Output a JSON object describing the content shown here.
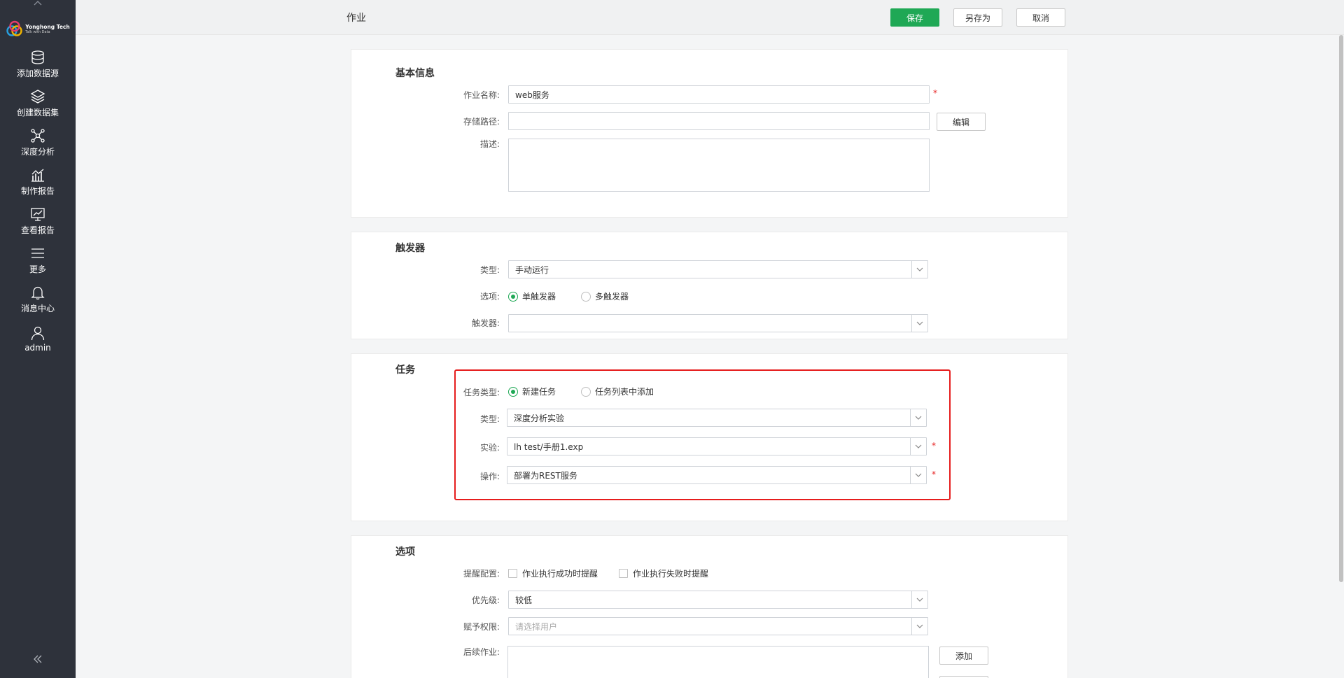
{
  "sidebar": {
    "logo": {
      "line1": "Yonghong Tech",
      "line2": "Talk with Data"
    },
    "items": [
      {
        "label": "添加数据源",
        "icon": "database-icon"
      },
      {
        "label": "创建数据集",
        "icon": "layers-icon"
      },
      {
        "label": "深度分析",
        "icon": "network-icon"
      },
      {
        "label": "制作报告",
        "icon": "bar-chart-icon"
      },
      {
        "label": "查看报告",
        "icon": "monitor-chart-icon"
      },
      {
        "label": "更多",
        "icon": "menu-icon"
      },
      {
        "label": "消息中心",
        "icon": "bell-icon"
      },
      {
        "label": "admin",
        "icon": "user-icon"
      }
    ],
    "collapse_icon": "double-chevron-left-icon"
  },
  "header": {
    "title": "作业",
    "save_label": "保存",
    "save_as_label": "另存为",
    "cancel_label": "取消"
  },
  "basic": {
    "title": "基本信息",
    "name_label": "作业名称:",
    "name_value": "web服务",
    "path_label": "存储路径:",
    "path_value": "",
    "edit_label": "编辑",
    "desc_label": "描述:",
    "required_mark": "*"
  },
  "trigger": {
    "title": "触发器",
    "type_label": "类型:",
    "type_value": "手动运行",
    "option_label": "选项:",
    "option_single": "单触发器",
    "option_multi": "多触发器",
    "trigger_label": "触发器:",
    "trigger_value": ""
  },
  "task": {
    "title": "任务",
    "task_type_label": "任务类型:",
    "task_type_new": "新建任务",
    "task_type_list": "任务列表中添加",
    "type_label": "类型:",
    "type_value": "深度分析实验",
    "experiment_label": "实验:",
    "experiment_value": "lh test/手册1.exp",
    "operation_label": "操作:",
    "operation_value": "部署为REST服务",
    "required_mark": "*"
  },
  "options": {
    "title": "选项",
    "alert_label": "提醒配置:",
    "alert_success": "作业执行成功时提醒",
    "alert_failure": "作业执行失败时提醒",
    "priority_label": "优先级:",
    "priority_value": "较低",
    "permission_label": "赋予权限:",
    "permission_placeholder": "请选择用户",
    "followup_label": "后续作业:",
    "add_label": "添加"
  },
  "colors": {
    "sidebar_bg": "#2e323b",
    "primary_green": "#1fa855",
    "highlight_red": "#e61d1d"
  }
}
